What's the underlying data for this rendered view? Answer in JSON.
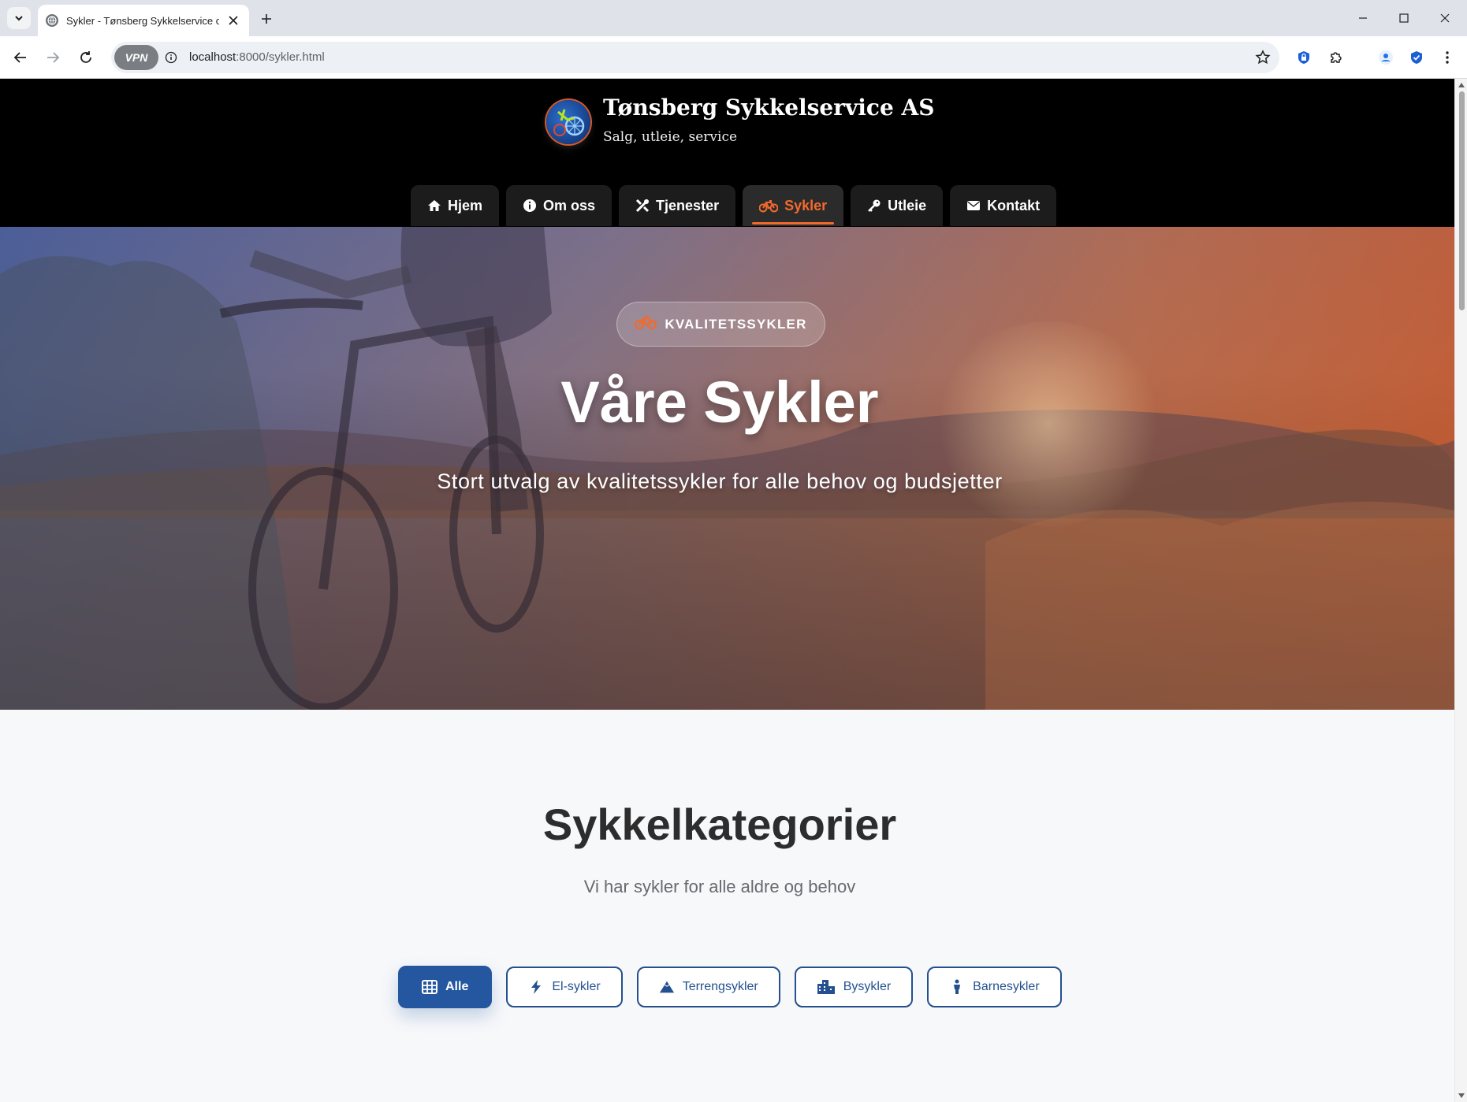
{
  "browser": {
    "tab_title": "Sykler - Tønsberg Sykkelservice og",
    "url_host": "localhost",
    "url_rest": ":8000/sykler.html",
    "vpn_label": "VPN"
  },
  "site": {
    "brand_title": "Tønsberg Sykkelservice AS",
    "brand_subtitle": "Salg, utleie, service",
    "nav": [
      {
        "label": "Hjem",
        "icon": "home-icon"
      },
      {
        "label": "Om oss",
        "icon": "info-icon"
      },
      {
        "label": "Tjenester",
        "icon": "tools-icon"
      },
      {
        "label": "Sykler",
        "icon": "bicycle-icon",
        "active": true
      },
      {
        "label": "Utleie",
        "icon": "key-icon"
      },
      {
        "label": "Kontakt",
        "icon": "envelope-icon"
      }
    ]
  },
  "hero": {
    "badge": "KVALITETSSYKLER",
    "title": "Våre Sykler",
    "subtitle": "Stort utvalg av kvalitetssykler for alle behov og budsjetter"
  },
  "categories": {
    "title": "Sykkelkategorier",
    "subtitle": "Vi har sykler for alle aldre og behov",
    "filters": [
      {
        "label": "Alle",
        "icon": "grid-icon",
        "active": true
      },
      {
        "label": "El-sykler",
        "icon": "bolt-icon"
      },
      {
        "label": "Terrengsykler",
        "icon": "mountain-icon"
      },
      {
        "label": "Bysykler",
        "icon": "city-icon"
      },
      {
        "label": "Barnesykler",
        "icon": "child-icon"
      }
    ]
  },
  "colors": {
    "accent_orange": "#f36a2d",
    "primary_blue": "#24579f",
    "header_bg": "#000000"
  }
}
